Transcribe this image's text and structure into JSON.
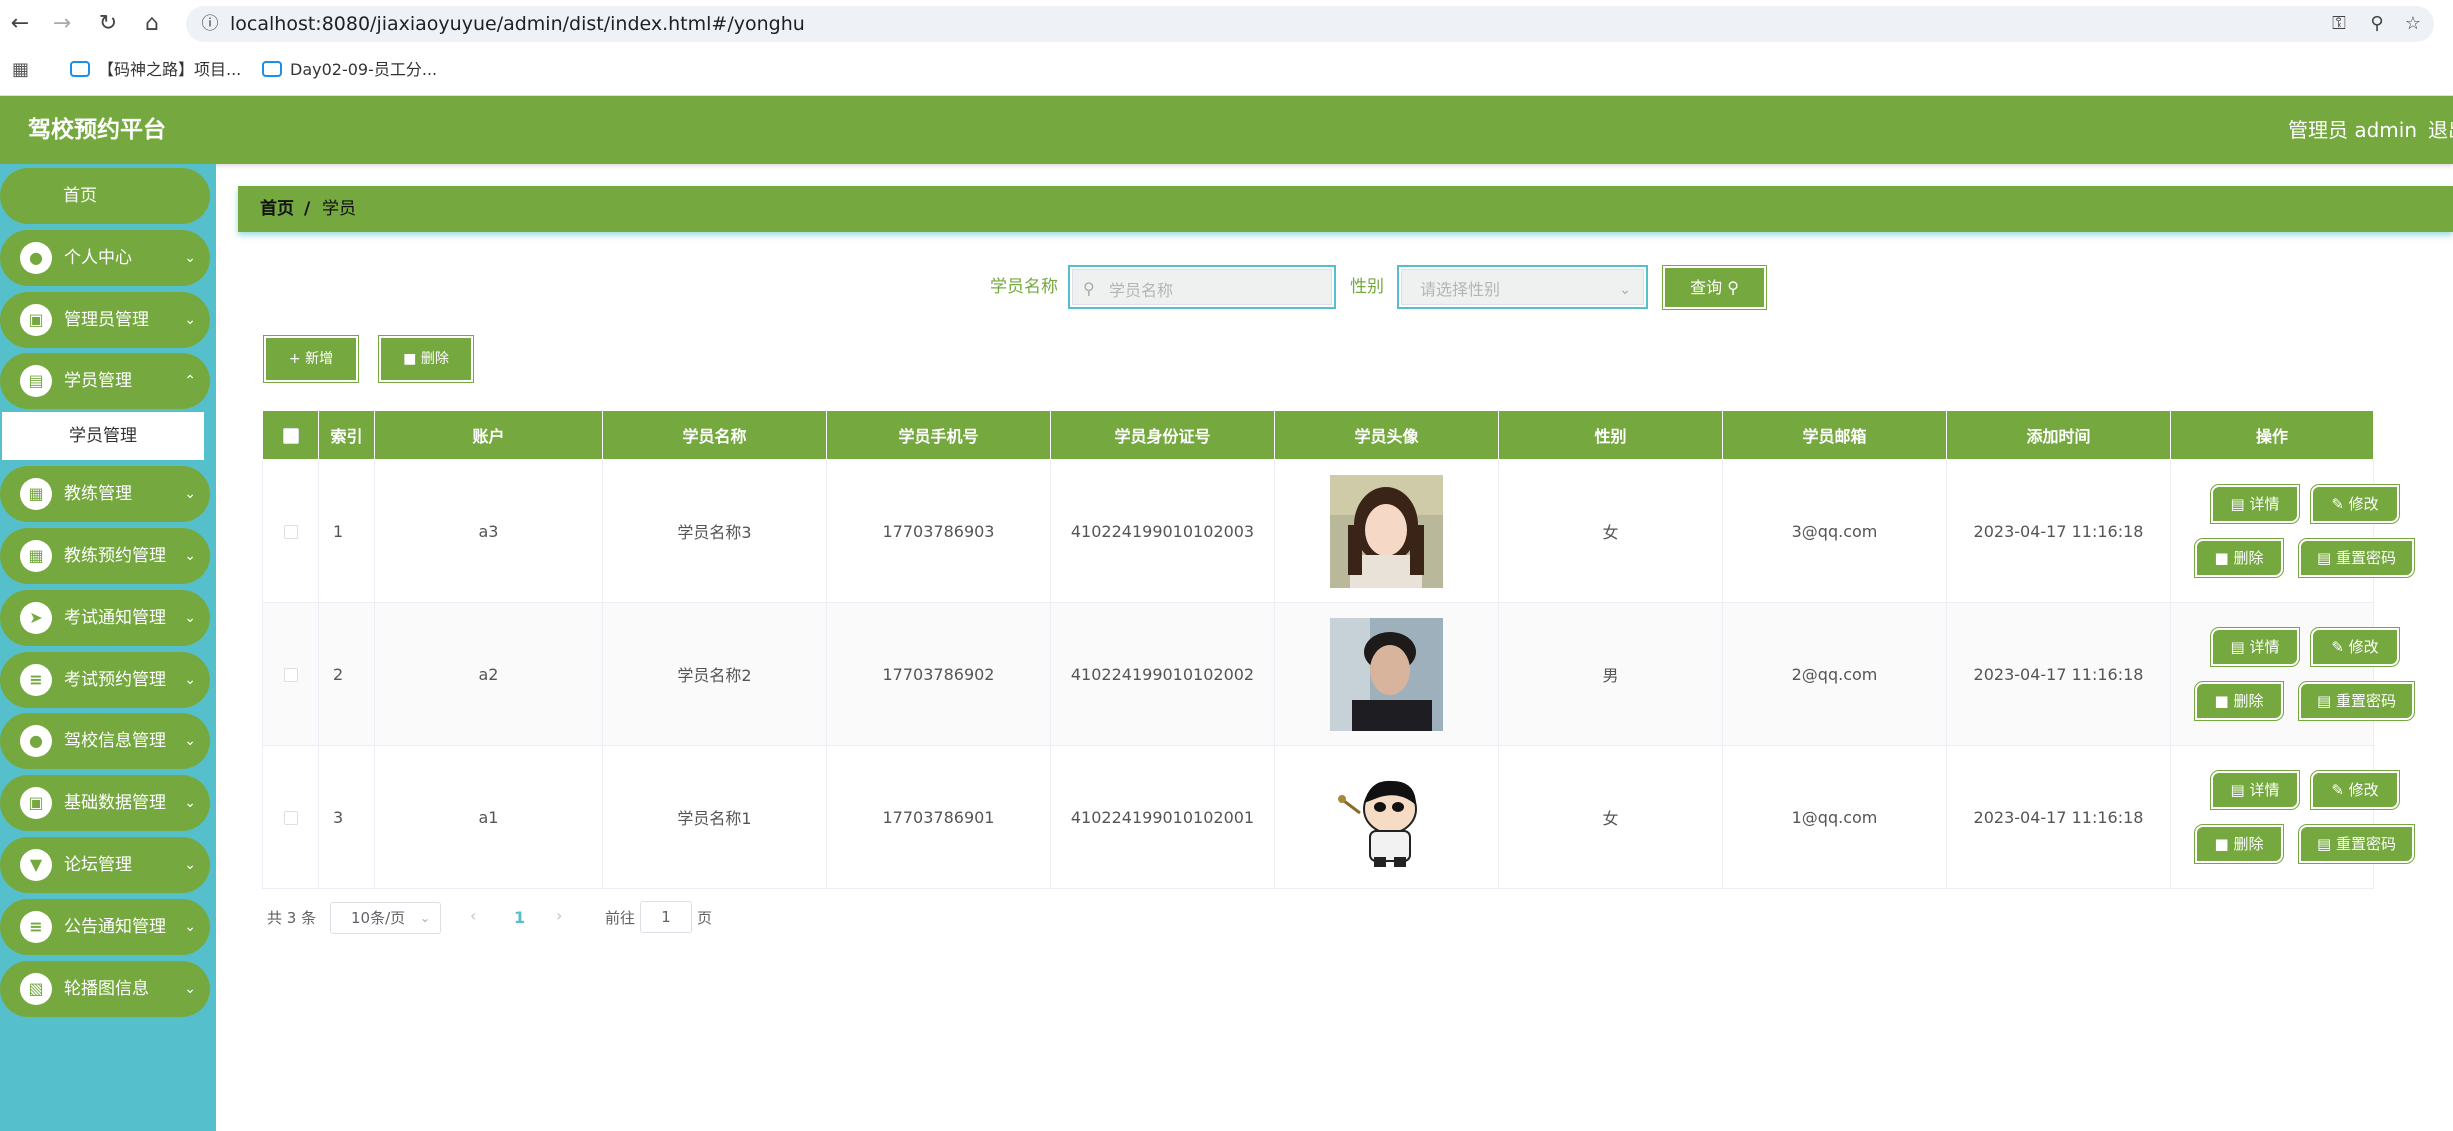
{
  "browser": {
    "url": "localhost:8080/jiaxiaoyuyue/admin/dist/index.html#/yonghu",
    "bookmarks": [
      "【码神之路】项目...",
      "Day02-09-员工分..."
    ]
  },
  "header": {
    "title": "驾校预约平台",
    "admin_label": "管理员 admin",
    "logout_label": "退出"
  },
  "sidebar": {
    "home": "首页",
    "items": [
      {
        "label": "个人中心",
        "icon": "user-icon"
      },
      {
        "label": "管理员管理",
        "icon": "briefcase-icon"
      },
      {
        "label": "学员管理",
        "icon": "chart-icon"
      },
      {
        "label": "教练管理",
        "icon": "grid-icon"
      },
      {
        "label": "教练预约管理",
        "icon": "grid-icon"
      },
      {
        "label": "考试通知管理",
        "icon": "send-icon"
      },
      {
        "label": "考试预约管理",
        "icon": "list-icon"
      },
      {
        "label": "驾校信息管理",
        "icon": "user-icon"
      },
      {
        "label": "基础数据管理",
        "icon": "briefcase-icon"
      },
      {
        "label": "论坛管理",
        "icon": "pin-icon"
      },
      {
        "label": "公告通知管理",
        "icon": "sliders-icon"
      },
      {
        "label": "轮播图信息",
        "icon": "book-icon"
      }
    ],
    "sub_item": "学员管理"
  },
  "breadcrumb": {
    "home": "首页",
    "separator": "/",
    "current": "学员"
  },
  "search": {
    "name_label": "学员名称",
    "name_placeholder": "学员名称",
    "gender_label": "性别",
    "gender_placeholder": "请选择性别",
    "query_button": "查询"
  },
  "actions": {
    "add": "新增",
    "delete": "删除"
  },
  "table": {
    "columns": [
      "索引",
      "账户",
      "学员名称",
      "学员手机号",
      "学员身份证号",
      "学员头像",
      "性别",
      "学员邮箱",
      "添加时间",
      "操作"
    ],
    "rows": [
      {
        "index": "1",
        "account": "a3",
        "name": "学员名称3",
        "phone": "17703786903",
        "id_card": "410224199010102003",
        "gender": "女",
        "email": "3@qq.com",
        "created": "2023-04-17 11:16:18"
      },
      {
        "index": "2",
        "account": "a2",
        "name": "学员名称2",
        "phone": "17703786902",
        "id_card": "410224199010102002",
        "gender": "男",
        "email": "2@qq.com",
        "created": "2023-04-17 11:16:18"
      },
      {
        "index": "3",
        "account": "a1",
        "name": "学员名称1",
        "phone": "17703786901",
        "id_card": "410224199010102001",
        "gender": "女",
        "email": "1@qq.com",
        "created": "2023-04-17 11:16:18"
      }
    ],
    "op_labels": {
      "detail": "详情",
      "edit": "修改",
      "delete": "删除",
      "reset": "重置密码"
    }
  },
  "pagination": {
    "total": "共 3 条",
    "page_size": "10条/页",
    "current_page": "1",
    "goto_label": "前往",
    "goto_value": "1",
    "page_suffix": "页"
  },
  "colors": {
    "primary": "#75a93f",
    "sidebar_bg": "#55c0cc",
    "accent": "#55c0cc"
  }
}
